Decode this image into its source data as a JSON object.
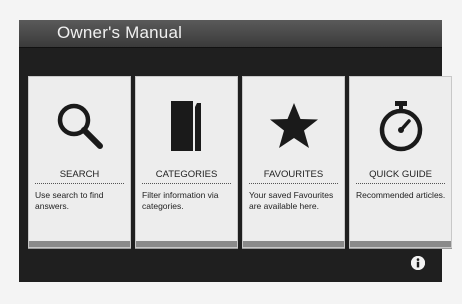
{
  "header": {
    "title": "Owner's Manual"
  },
  "cards": [
    {
      "label": "SEARCH",
      "description": "Use search to find answers.",
      "icon": "magnifier-icon"
    },
    {
      "label": "CATEGORIES",
      "description": "Filter information via categories.",
      "icon": "book-icon"
    },
    {
      "label": "FAVOURITES",
      "description": "Your saved Favourites are available here.",
      "icon": "star-icon"
    },
    {
      "label": "QUICK GUIDE",
      "description": "Recommended articles.",
      "icon": "stopwatch-icon"
    }
  ],
  "info_button": {
    "icon": "info-icon"
  },
  "colors": {
    "background": "#1f1f1f",
    "card": "#ededed",
    "icon": "#1a1a1a"
  }
}
